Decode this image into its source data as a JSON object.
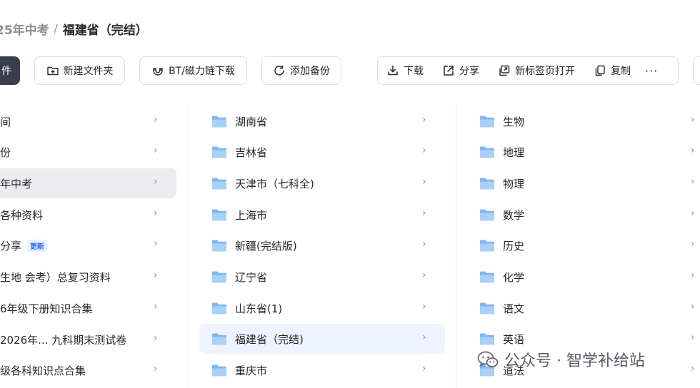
{
  "breadcrumb": {
    "previous": "25年中考",
    "separator": "/",
    "current": "福建省（完结）"
  },
  "toolbar": {
    "primary_label": "件",
    "new_folder_label": "新建文件夹",
    "bt_download_label": "BT/磁力链下载",
    "add_backup_label": "添加备份",
    "download_label": "下载",
    "share_label": "分享",
    "open_new_tab_label": "新标签页打开",
    "copy_label": "复制",
    "more_label": "···"
  },
  "column1": {
    "items": [
      {
        "label": "间"
      },
      {
        "label": "份"
      },
      {
        "label": "年中考",
        "active": true
      },
      {
        "label": "各种资料"
      },
      {
        "label": "分享",
        "badge": "更新"
      },
      {
        "label": "生地 会考）总复习资料"
      },
      {
        "label": "6年级下册知识合集"
      },
      {
        "label": "2026年... 九科期末测试卷"
      },
      {
        "label": "级各科知识点合集"
      }
    ]
  },
  "column2": {
    "items": [
      {
        "label": "湖南省"
      },
      {
        "label": "吉林省"
      },
      {
        "label": "天津市（七科全)"
      },
      {
        "label": "上海市"
      },
      {
        "label": "新疆(完结版)"
      },
      {
        "label": "辽宁省"
      },
      {
        "label": "山东省(1)"
      },
      {
        "label": "福建省（完结)",
        "selected": true
      },
      {
        "label": "重庆市"
      }
    ]
  },
  "column3": {
    "items": [
      {
        "label": "生物"
      },
      {
        "label": "地理"
      },
      {
        "label": "物理"
      },
      {
        "label": "数学"
      },
      {
        "label": "历史"
      },
      {
        "label": "化学"
      },
      {
        "label": "语文"
      },
      {
        "label": "英语"
      },
      {
        "label": "道法"
      }
    ]
  },
  "watermark": {
    "text": "公众号 · 智学补给站"
  },
  "colors": {
    "primary_button": "#3a3d4a",
    "selected_row": "#eef3ff",
    "active_row": "#ececef",
    "folder_blue": "#7fb6ef",
    "badge_blue": "#2f6bff"
  }
}
